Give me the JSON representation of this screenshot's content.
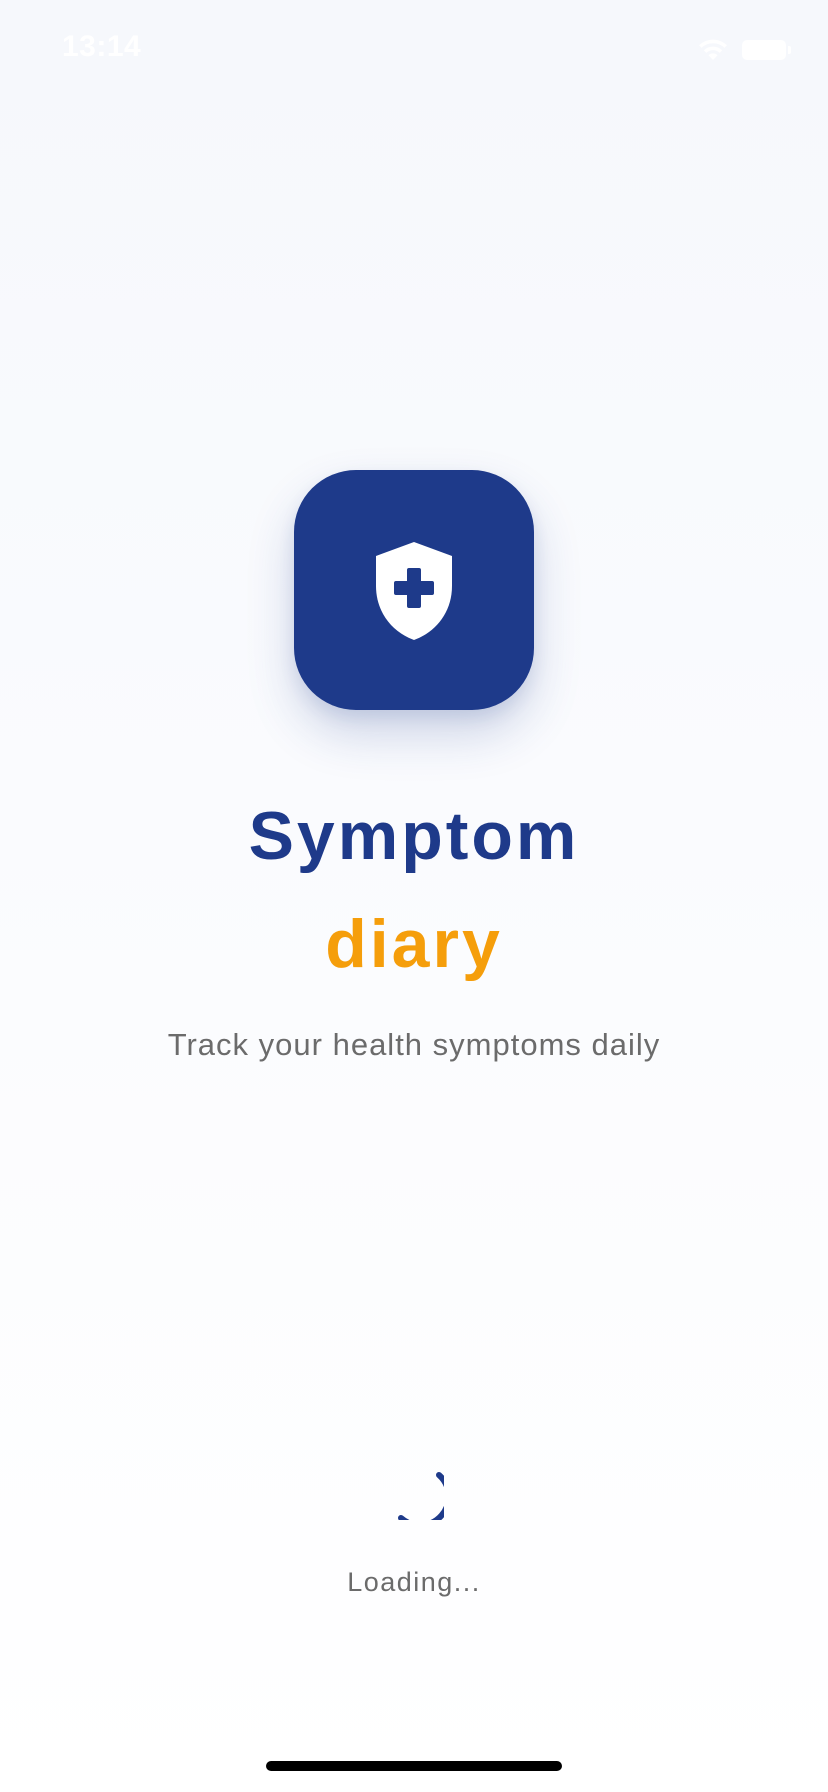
{
  "status_bar": {
    "time": "13:14",
    "icons": [
      "wifi-icon",
      "battery-icon"
    ]
  },
  "logo": {
    "icon": "shield-plus-icon",
    "background_color": "#1e3a8a"
  },
  "title": {
    "line1": "Symptom",
    "line2": "diary",
    "line1_color": "#1e3a8a",
    "line2_color": "#f59e0b"
  },
  "subtitle": "Track your health symptoms daily",
  "loading": {
    "icon": "spinner-icon",
    "text": "Loading..."
  }
}
